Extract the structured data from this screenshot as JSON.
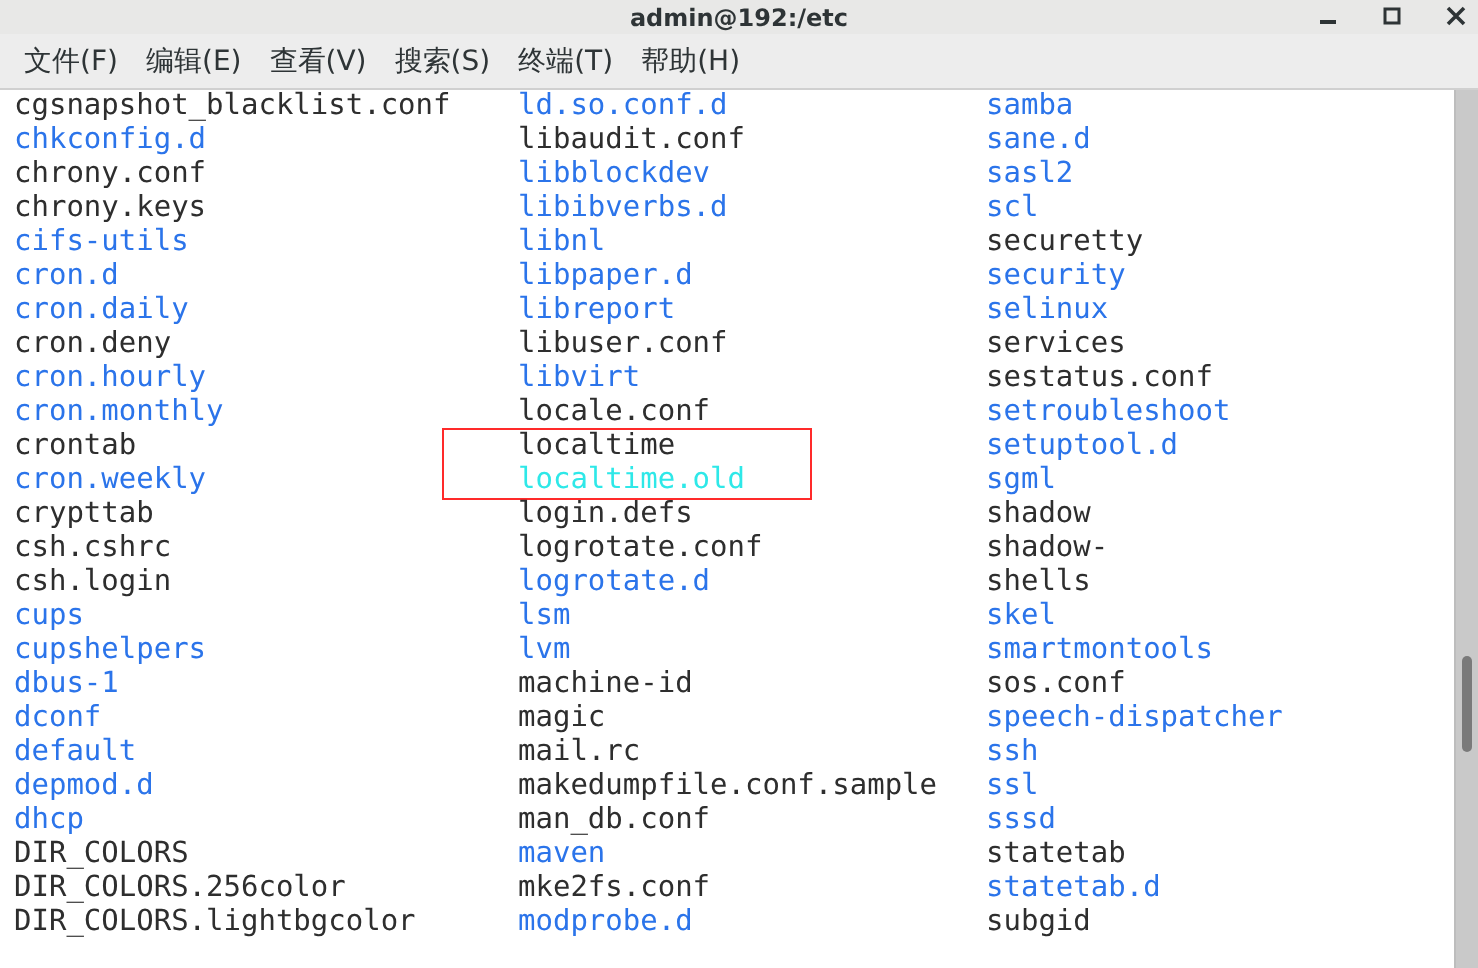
{
  "window": {
    "title": "admin@192:/etc"
  },
  "menu": [
    {
      "label": "文件(F)"
    },
    {
      "label": "编辑(E)"
    },
    {
      "label": "查看(V)"
    },
    {
      "label": "搜索(S)"
    },
    {
      "label": "终端(T)"
    },
    {
      "label": "帮助(H)"
    }
  ],
  "columns": [
    [
      {
        "name": "cgsnapshot_blacklist.conf",
        "kind": "file"
      },
      {
        "name": "chkconfig.d",
        "kind": "dir"
      },
      {
        "name": "chrony.conf",
        "kind": "file"
      },
      {
        "name": "chrony.keys",
        "kind": "file"
      },
      {
        "name": "cifs-utils",
        "kind": "dir"
      },
      {
        "name": "cron.d",
        "kind": "dir"
      },
      {
        "name": "cron.daily",
        "kind": "dir"
      },
      {
        "name": "cron.deny",
        "kind": "file"
      },
      {
        "name": "cron.hourly",
        "kind": "dir"
      },
      {
        "name": "cron.monthly",
        "kind": "dir"
      },
      {
        "name": "crontab",
        "kind": "file"
      },
      {
        "name": "cron.weekly",
        "kind": "dir"
      },
      {
        "name": "crypttab",
        "kind": "file"
      },
      {
        "name": "csh.cshrc",
        "kind": "file"
      },
      {
        "name": "csh.login",
        "kind": "file"
      },
      {
        "name": "cups",
        "kind": "dir"
      },
      {
        "name": "cupshelpers",
        "kind": "dir"
      },
      {
        "name": "dbus-1",
        "kind": "dir"
      },
      {
        "name": "dconf",
        "kind": "dir"
      },
      {
        "name": "default",
        "kind": "dir"
      },
      {
        "name": "depmod.d",
        "kind": "dir"
      },
      {
        "name": "dhcp",
        "kind": "dir"
      },
      {
        "name": "DIR_COLORS",
        "kind": "file"
      },
      {
        "name": "DIR_COLORS.256color",
        "kind": "file"
      },
      {
        "name": "DIR_COLORS.lightbgcolor",
        "kind": "file"
      }
    ],
    [
      {
        "name": "ld.so.conf.d",
        "kind": "dir"
      },
      {
        "name": "libaudit.conf",
        "kind": "file"
      },
      {
        "name": "libblockdev",
        "kind": "dir"
      },
      {
        "name": "libibverbs.d",
        "kind": "dir"
      },
      {
        "name": "libnl",
        "kind": "dir"
      },
      {
        "name": "libpaper.d",
        "kind": "dir"
      },
      {
        "name": "libreport",
        "kind": "dir"
      },
      {
        "name": "libuser.conf",
        "kind": "file"
      },
      {
        "name": "libvirt",
        "kind": "dir"
      },
      {
        "name": "locale.conf",
        "kind": "file"
      },
      {
        "name": "localtime",
        "kind": "file",
        "highlighted": true
      },
      {
        "name": "localtime.old",
        "kind": "link",
        "highlighted": true
      },
      {
        "name": "login.defs",
        "kind": "file"
      },
      {
        "name": "logrotate.conf",
        "kind": "file"
      },
      {
        "name": "logrotate.d",
        "kind": "dir"
      },
      {
        "name": "lsm",
        "kind": "dir"
      },
      {
        "name": "lvm",
        "kind": "dir"
      },
      {
        "name": "machine-id",
        "kind": "file"
      },
      {
        "name": "magic",
        "kind": "file"
      },
      {
        "name": "mail.rc",
        "kind": "file"
      },
      {
        "name": "makedumpfile.conf.sample",
        "kind": "file"
      },
      {
        "name": "man_db.conf",
        "kind": "file"
      },
      {
        "name": "maven",
        "kind": "dir"
      },
      {
        "name": "mke2fs.conf",
        "kind": "file"
      },
      {
        "name": "modprobe.d",
        "kind": "dir"
      }
    ],
    [
      {
        "name": "samba",
        "kind": "dir"
      },
      {
        "name": "sane.d",
        "kind": "dir"
      },
      {
        "name": "sasl2",
        "kind": "dir"
      },
      {
        "name": "scl",
        "kind": "dir"
      },
      {
        "name": "securetty",
        "kind": "file"
      },
      {
        "name": "security",
        "kind": "dir"
      },
      {
        "name": "selinux",
        "kind": "dir"
      },
      {
        "name": "services",
        "kind": "file"
      },
      {
        "name": "sestatus.conf",
        "kind": "file"
      },
      {
        "name": "setroubleshoot",
        "kind": "dir"
      },
      {
        "name": "setuptool.d",
        "kind": "dir"
      },
      {
        "name": "sgml",
        "kind": "dir"
      },
      {
        "name": "shadow",
        "kind": "file"
      },
      {
        "name": "shadow-",
        "kind": "file"
      },
      {
        "name": "shells",
        "kind": "file"
      },
      {
        "name": "skel",
        "kind": "dir"
      },
      {
        "name": "smartmontools",
        "kind": "dir"
      },
      {
        "name": "sos.conf",
        "kind": "file"
      },
      {
        "name": "speech-dispatcher",
        "kind": "dir"
      },
      {
        "name": "ssh",
        "kind": "dir"
      },
      {
        "name": "ssl",
        "kind": "dir"
      },
      {
        "name": "sssd",
        "kind": "dir"
      },
      {
        "name": "statetab",
        "kind": "file"
      },
      {
        "name": "statetab.d",
        "kind": "dir"
      },
      {
        "name": "subgid",
        "kind": "file"
      }
    ]
  ]
}
